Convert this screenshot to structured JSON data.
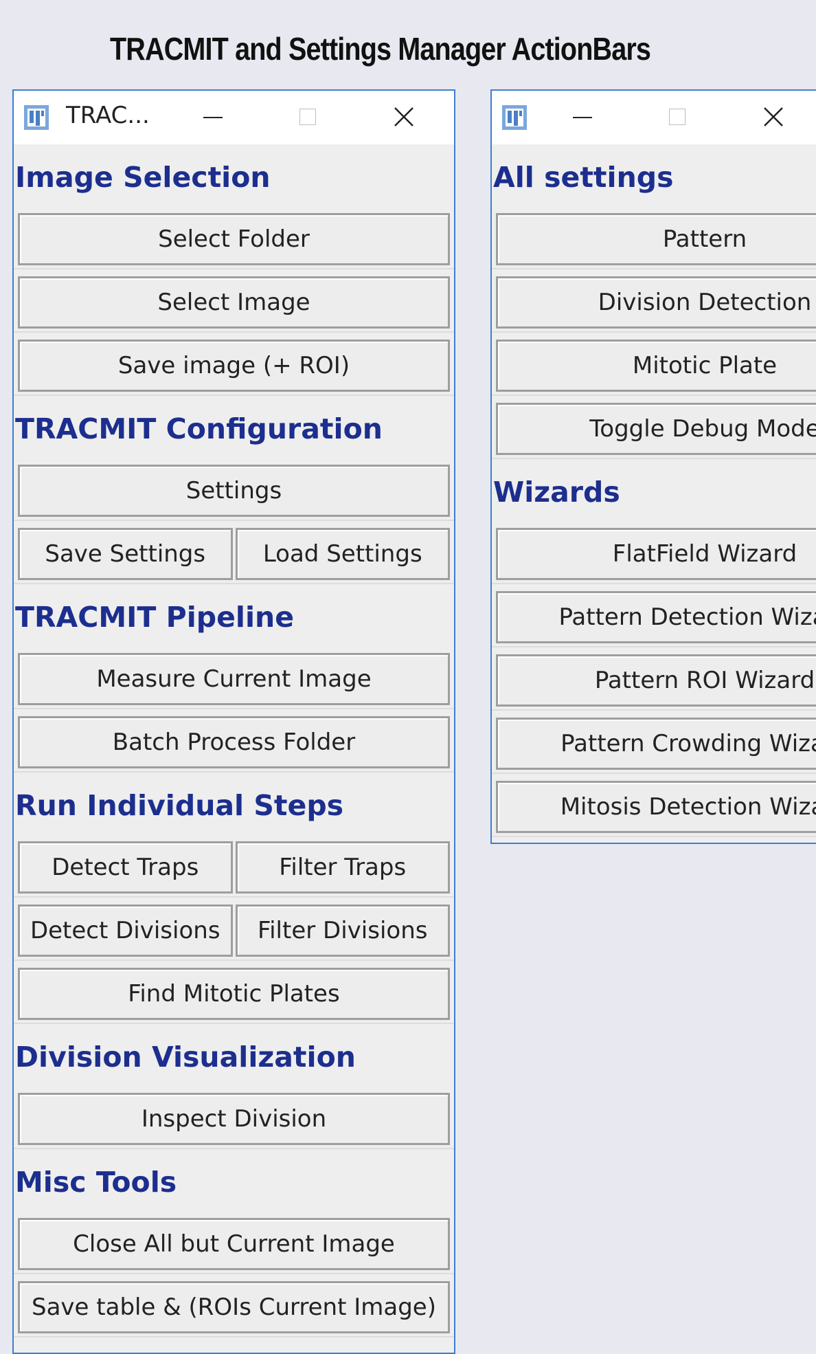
{
  "page_title": "TRACMIT and Settings Manager ActionBars",
  "left_window": {
    "title": "TRAC...",
    "sections": [
      {
        "heading": "Image Selection",
        "rows": [
          [
            "Select Folder"
          ],
          [
            "Select Image"
          ],
          [
            "Save image (+ ROI)"
          ]
        ]
      },
      {
        "heading": "TRACMIT Configuration",
        "rows": [
          [
            "Settings"
          ],
          [
            "Save Settings",
            "Load Settings"
          ]
        ]
      },
      {
        "heading": "TRACMIT Pipeline",
        "rows": [
          [
            "Measure Current Image"
          ],
          [
            "Batch Process Folder"
          ]
        ]
      },
      {
        "heading": "Run Individual Steps",
        "rows": [
          [
            "Detect Traps",
            "Filter Traps"
          ],
          [
            "Detect Divisions",
            "Filter Divisions"
          ],
          [
            "Find Mitotic Plates"
          ]
        ]
      },
      {
        "heading": "Division Visualization",
        "rows": [
          [
            "Inspect Division"
          ]
        ]
      },
      {
        "heading": "Misc Tools",
        "rows": [
          [
            "Close All but Current Image"
          ],
          [
            "Save table & (ROIs Current Image)"
          ]
        ]
      }
    ]
  },
  "right_window": {
    "title": "",
    "sections": [
      {
        "heading": "All settings",
        "rows": [
          [
            "Pattern"
          ],
          [
            "Division Detection"
          ],
          [
            "Mitotic Plate"
          ],
          [
            "Toggle Debug Mode"
          ]
        ]
      },
      {
        "heading": "Wizards",
        "rows": [
          [
            "FlatField Wizard"
          ],
          [
            "Pattern Detection Wizard"
          ],
          [
            "Pattern ROI Wizard"
          ],
          [
            "Pattern Crowding Wizard"
          ],
          [
            "Mitosis Detection Wizard"
          ]
        ]
      }
    ]
  },
  "colors": {
    "section_heading": "#1c2e8e",
    "window_border": "#3c7fd0",
    "button_border": "#9e9e9e"
  },
  "icons": {
    "app": "imagej-icon",
    "minimize": "minimize-icon",
    "maximize": "maximize-icon",
    "close": "close-icon"
  }
}
